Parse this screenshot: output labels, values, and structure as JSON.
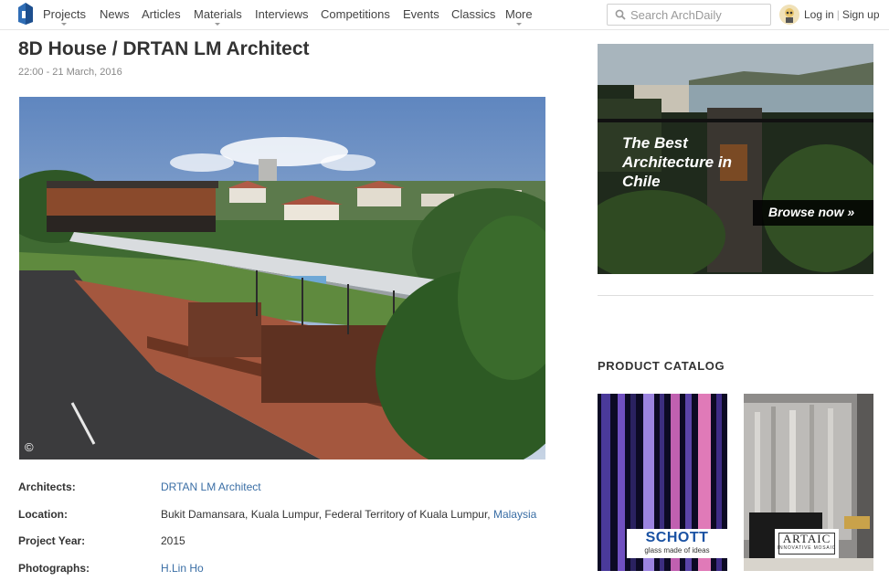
{
  "nav": {
    "logo_icon": "archdaily-logo-icon",
    "items": [
      {
        "label": "Projects",
        "has_dropdown": true
      },
      {
        "label": "News",
        "has_dropdown": false
      },
      {
        "label": "Articles",
        "has_dropdown": false
      },
      {
        "label": "Materials",
        "has_dropdown": true
      },
      {
        "label": "Interviews",
        "has_dropdown": false
      },
      {
        "label": "Competitions",
        "has_dropdown": false
      },
      {
        "label": "Events",
        "has_dropdown": false
      },
      {
        "label": "Classics",
        "has_dropdown": false
      },
      {
        "label": "More",
        "has_dropdown": true
      }
    ],
    "search_placeholder": "Search ArchDaily",
    "search_icon": "search-icon",
    "login_label": "Log in",
    "signup_label": "Sign up"
  },
  "article": {
    "title": "8D House / DRTAN LM Architect",
    "date": "22:00 - 21 March, 2016",
    "hero_copyright": "©",
    "specs": [
      {
        "label": "Architects:",
        "value": "DRTAN LM Architect",
        "link": true
      },
      {
        "label": "Location:",
        "value": "Bukit Damansara, Kuala Lumpur, Federal Territory of Kuala Lumpur, ",
        "link_text": "Malaysia"
      },
      {
        "label": "Project Year:",
        "value": "2015",
        "link": false
      },
      {
        "label": "Photographs:",
        "value": "H.Lin Ho",
        "link": true
      }
    ]
  },
  "sidebar": {
    "ad": {
      "headline": "The Best Architecture in Chile",
      "cta": "Browse now »"
    },
    "catalog_heading": "PRODUCT CATALOG",
    "products": [
      {
        "brand": "SCHOTT",
        "tagline": "glass made of ideas"
      },
      {
        "brand": "ARTAIC",
        "tagline": "INNOVATIVE MOSAIC"
      }
    ]
  },
  "colors": {
    "link": "#3a6ea5",
    "text": "#333333",
    "muted": "#888888",
    "schott_blue": "#1a52a3"
  }
}
